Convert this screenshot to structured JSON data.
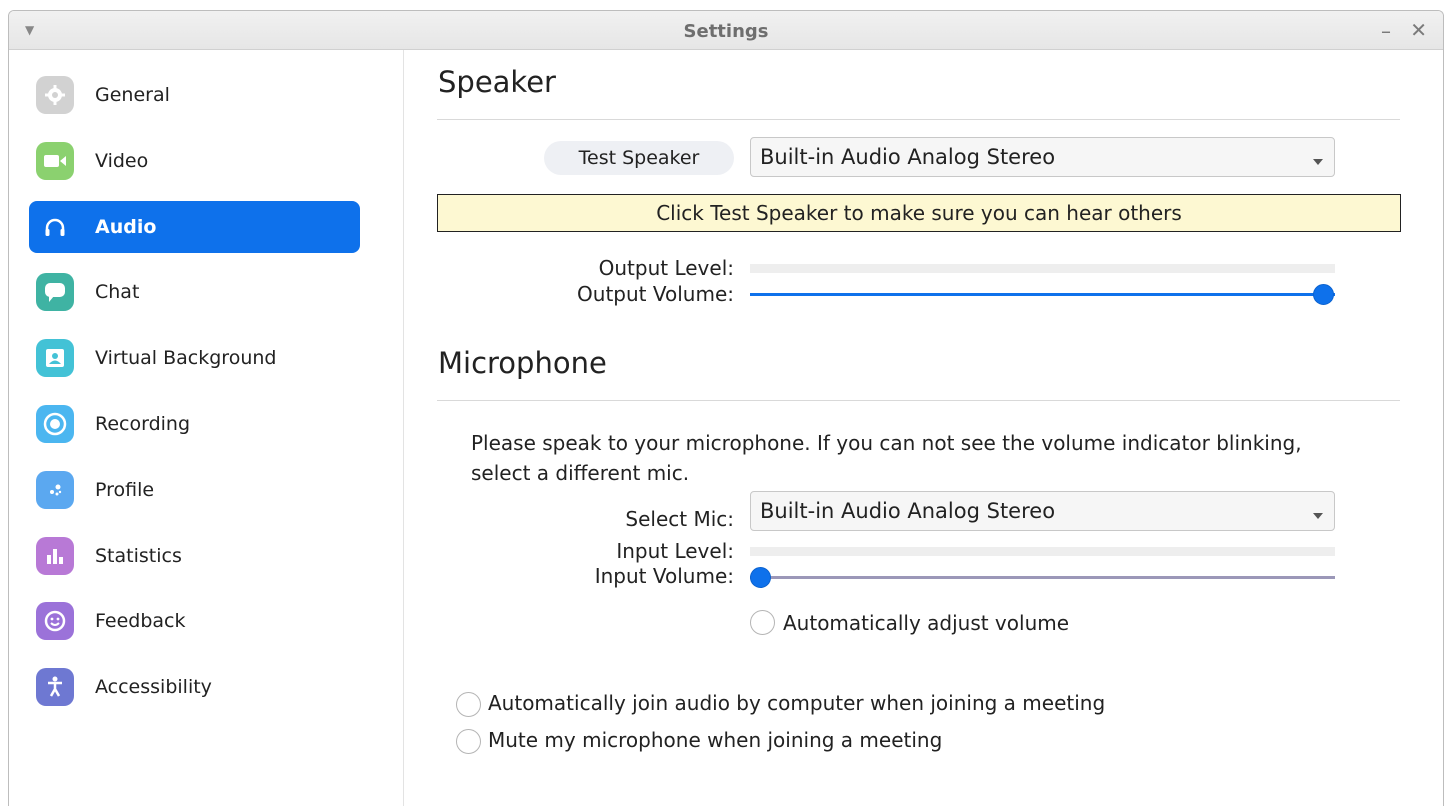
{
  "window": {
    "title": "Settings",
    "menu_icon": "caret-down-icon",
    "minimize_icon": "minimize-icon",
    "close_icon": "close-icon"
  },
  "sidebar": {
    "active_index": 2,
    "items": [
      {
        "label": "General",
        "icon": "gear-icon",
        "color": "#cfcfcf"
      },
      {
        "label": "Video",
        "icon": "video-camera-icon",
        "color": "#8bd16f"
      },
      {
        "label": "Audio",
        "icon": "headphones-icon",
        "color": "#0e71eb"
      },
      {
        "label": "Chat",
        "icon": "chat-bubble-icon",
        "color": "#3fb3a3"
      },
      {
        "label": "Virtual Background",
        "icon": "person-frame-icon",
        "color": "#43c2d6"
      },
      {
        "label": "Recording",
        "icon": "record-icon",
        "color": "#4bb6f0"
      },
      {
        "label": "Profile",
        "icon": "profile-icon",
        "color": "#5ba8f0"
      },
      {
        "label": "Statistics",
        "icon": "bar-chart-icon",
        "color": "#b879d6"
      },
      {
        "label": "Feedback",
        "icon": "smiley-icon",
        "color": "#9b72d9"
      },
      {
        "label": "Accessibility",
        "icon": "accessibility-icon",
        "color": "#6e78d2"
      }
    ]
  },
  "speaker": {
    "title": "Speaker",
    "test_button": "Test Speaker",
    "device": "Built-in Audio Analog Stereo",
    "hint": "Click Test Speaker to make sure you can hear others",
    "output_level_label": "Output Level:",
    "output_level": 0,
    "output_volume_label": "Output Volume:",
    "output_volume": 1.0
  },
  "microphone": {
    "title": "Microphone",
    "instructions": "Please speak to your microphone. If you can not see the volume indicator blinking, select a different mic.",
    "select_label": "Select Mic:",
    "device": "Built-in Audio Analog Stereo",
    "input_level_label": "Input Level:",
    "input_level": 0,
    "input_volume_label": "Input Volume:",
    "input_volume": 0.0,
    "auto_adjust_label": "Automatically adjust volume",
    "auto_adjust": false
  },
  "options": {
    "auto_join_label": "Automatically join audio by computer when joining a meeting",
    "auto_join": true,
    "mute_label": "Mute my microphone when joining a meeting",
    "mute": false
  },
  "colors": {
    "accent": "#0e71eb",
    "hint_background": "#fdf8d2",
    "input_track": "#9b97b8"
  }
}
